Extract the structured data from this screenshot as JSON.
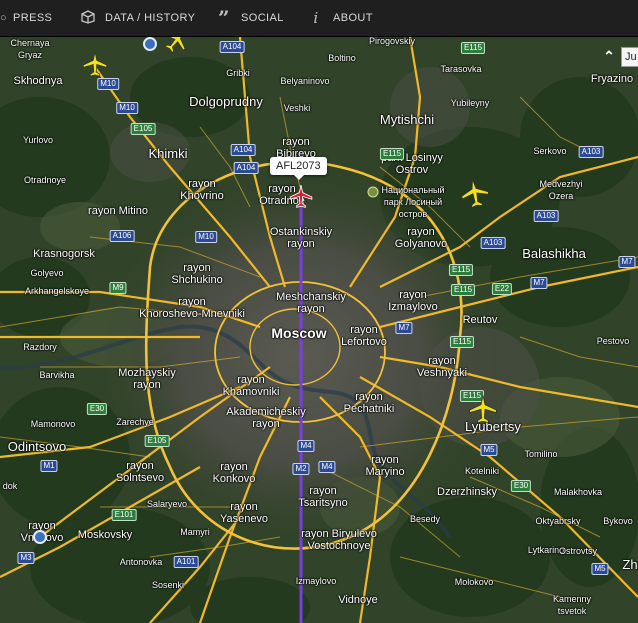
{
  "nav": {
    "items": [
      {
        "label": "PRESS",
        "icon": "globe-icon"
      },
      {
        "label": "DATA / HISTORY",
        "icon": "box-icon"
      },
      {
        "label": "SOCIAL",
        "icon": "quote-icon"
      },
      {
        "label": "ABOUT",
        "icon": "info-icon"
      }
    ]
  },
  "map": {
    "flight_label": "AFL2073",
    "date_tab": "Ju",
    "labels": {
      "chernaya_gryaz": "Chernaya\nGryaz",
      "skhodnya": "Skhodnya",
      "gribki": "Gribki",
      "boltino": "Boltino",
      "pirogovskiy": "Pirogovskiy",
      "tarasovka": "Tarasovka",
      "fryazino": "Fryazino",
      "belyaninovo": "Belyaninovo",
      "yubileyny": "Yubileyny",
      "dolgoprudny": "Dolgoprudny",
      "veshki": "Veshki",
      "mytishchi": "Mytishchi",
      "yurlovo": "Yurlovo",
      "khimki": "Khimki",
      "rayon_bibirevo": "rayon\nBibirevo",
      "serkovo": "Serkovo",
      "otradnoye_l": "Otradnoye",
      "rayon_khovrino": "rayon\nKhovrino",
      "rayon_otradnoe": "rayon\nOtradnoe",
      "park_losiny": "park Losinyy\nOstrov",
      "natsionalny": "Национальный\nпарк Лосиный\nостров",
      "medvezhyi": "Medvezhyi\nOzera",
      "rayon_mitino": "rayon Mitino",
      "ostankinskiy": "Ostankinskiy\nrayon",
      "krasnogorsk": "Krasnogorsk",
      "rayon_golyanovo": "rayon\nGolyanovo",
      "balashikha": "Balashikha",
      "golyevo": "Golyevo",
      "rayon_shchukino": "rayon\nShchukino",
      "arkhangelskoye": "Arkhangelskoye",
      "meshchanskiy": "Meshchanskiy\nrayon",
      "rayon_izmaylovo": "rayon\nIzmaylovo",
      "reutov": "Reutov",
      "khoroshevo": "rayon\nKhoroshevo-Mnevniki",
      "moscow": "Moscow",
      "rayon_lefortovo": "rayon\nLefortovo",
      "pestovo": "Pestovo",
      "razdory": "Razdory",
      "barvikha": "Barvikha",
      "mozhayskiy": "Mozhayskiy\nrayon",
      "rayon_khamovniki": "rayon\nKhamovniki",
      "rayon_veshnyaki": "rayon\nVeshnyaki",
      "mamonovo": "Mamonovo",
      "zarechye": "Zarechye",
      "akademicheskiy": "Akademicheskiy\nrayon",
      "rayon_pechatniki": "rayon\nPechatniki",
      "lyubertsy": "Lyubertsy",
      "odintsovo": "Odintsovo",
      "rayon_maryino": "rayon\nMaryino",
      "tomilino": "Tomilino",
      "rayon_solntsevo": "rayon\nSolntsevo",
      "rayon_konkovo": "rayon\nKonkovo",
      "kotelniki": "Kotelniki",
      "malakhovka": "Malakhovka",
      "dzerzhinsky": "Dzerzhinsky",
      "dok": "dok",
      "salaryevo": "Salaryevo",
      "rayon_tsaritsyno": "rayon\nTsaritsyno",
      "rayon_yasenevo": "rayon\nYasenevo",
      "besedy": "Besedy",
      "oktyabrsky": "Oktyabrsky",
      "bykovo": "Bykovo",
      "rayon_vnukovo": "rayon\nVnukovo",
      "moskovsky": "Moskovsky",
      "mamyri": "Mamyri",
      "biryulevo": "rayon Biryulevo\nVostochnoye",
      "lytkarino": "Lytkarino",
      "ostrovtsy": "Ostrovtsy",
      "antonovka": "Antonovka",
      "sosenki": "Sosenki",
      "izmaylovo_s": "Izmaylovo",
      "molokovo": "Molokovo",
      "vidnoye": "Vidnoye",
      "kamenny": "Kamenny\ntsvetok",
      "zh": "Zh"
    },
    "shields": {
      "m10_a": "M10",
      "m10_b": "M10",
      "m10_c": "M10",
      "a104_a": "A104",
      "a104_b": "A104",
      "a104_c": "A104",
      "e105_a": "E105",
      "e105_b": "E105",
      "e115_a": "E115",
      "e115_b": "E115",
      "e115_c": "E115",
      "e115_d": "E115",
      "e115_e": "E115",
      "e115_f": "E115",
      "a103_a": "A103",
      "a103_b": "A103",
      "a103_c": "A103",
      "a106": "A106",
      "m9": "M9",
      "e22": "E22",
      "m7_a": "M7",
      "m7_b": "M7",
      "m1": "M1",
      "e30_a": "E30",
      "e30_b": "E30",
      "m4_a": "M4",
      "m4_b": "M4",
      "m2": "M2",
      "m5_a": "M5",
      "m5_b": "M5",
      "e101": "E101",
      "a101": "A101",
      "m3": "M3",
      "m7_c": "M7"
    }
  }
}
